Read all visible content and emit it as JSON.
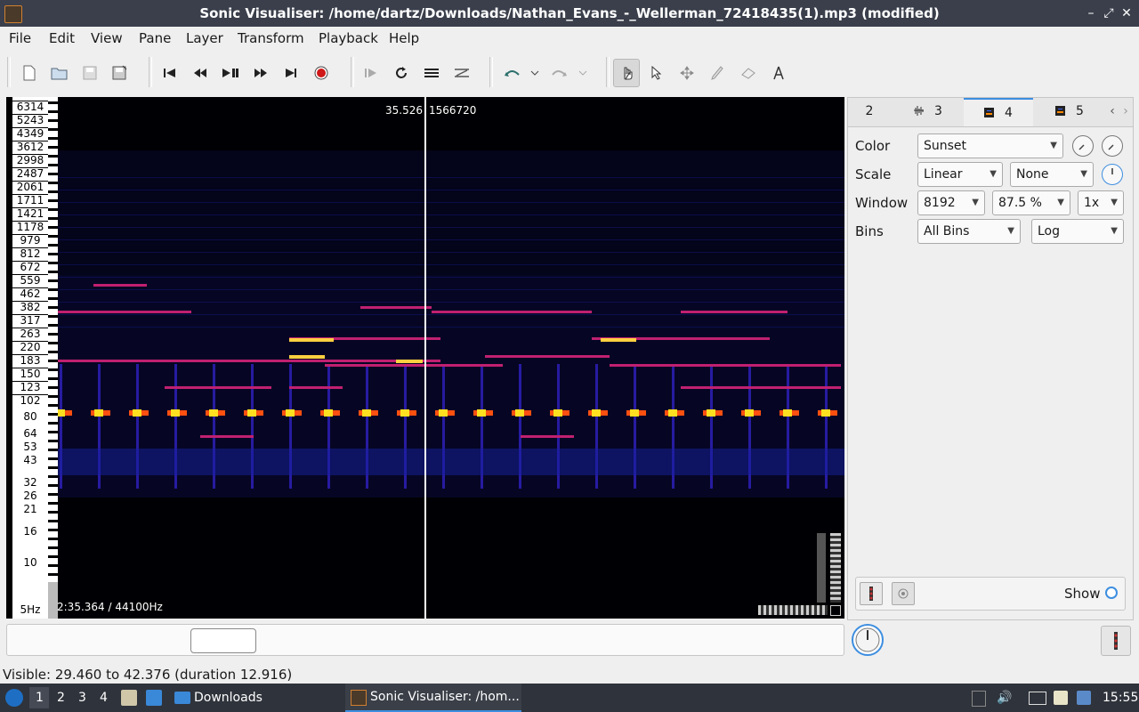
{
  "window": {
    "title": "Sonic Visualiser: /home/dartz/Downloads/Nathan_Evans_-_Wellerman_72418435(1).mp3 (modified)",
    "controls": {
      "minimize": "–",
      "maximize": "⤢",
      "close": "✕"
    }
  },
  "menu": [
    "File",
    "Edit",
    "View",
    "Pane",
    "Layer",
    "Transform",
    "Playback",
    "Help"
  ],
  "toolbar": {
    "icons": [
      "new-document-icon",
      "open-folder-icon",
      "save-icon",
      "save-session-icon",
      "rewind-start-icon",
      "rewind-icon",
      "play-pause-icon",
      "fast-forward-icon",
      "fast-forward-end-icon",
      "record-icon",
      "play-selection-icon",
      "loop-icon",
      "solo-icon",
      "playback-speedup-icon",
      "undo-icon",
      "undo-menu-icon",
      "redo-icon",
      "redo-menu-icon",
      "navigate-tool-icon",
      "select-tool-icon",
      "move-tool-icon",
      "draw-tool-icon",
      "erase-tool-icon",
      "measure-tool-icon"
    ]
  },
  "pane": {
    "scale_labels": [
      "6314",
      "5243",
      "4349",
      "3612",
      "2998",
      "2487",
      "2061",
      "1711",
      "1421",
      "1178",
      "979",
      "812",
      "672",
      "559",
      "462",
      "382",
      "317",
      "263",
      "220",
      "183",
      "150",
      "123",
      "102",
      "80",
      "64",
      "53",
      "43",
      "32",
      "26",
      "21",
      "16",
      "10",
      "5Hz"
    ],
    "cursor_time": "35.526",
    "cursor_frame": "1566720",
    "duration_rate": "2:35.364 / 44100Hz"
  },
  "layer_panel": {
    "tabs": [
      {
        "label": "2",
        "icon": ""
      },
      {
        "label": "3",
        "icon": "waveform-icon"
      },
      {
        "label": "4",
        "icon": "spectrogram-icon"
      },
      {
        "label": "5",
        "icon": "spectrogram-icon"
      }
    ],
    "active_tab": "4",
    "color_label": "Color",
    "color_value": "Sunset",
    "scale_label": "Scale",
    "scale_value": "Linear",
    "normalization_value": "None",
    "window_label": "Window",
    "window_size": "8192",
    "window_overlap": "87.5 %",
    "oversampling": "1x",
    "bins_label": "Bins",
    "bins_value": "All Bins",
    "bins_scale": "Log",
    "show_label": "Show"
  },
  "status": {
    "visible_range": "Visible: 29.460 to 42.376 (duration 12.916)"
  },
  "taskbar": {
    "workspaces": [
      "1",
      "2",
      "3",
      "4"
    ],
    "folder_label": "Downloads",
    "window_label": "Sonic Visualiser: /hom...",
    "clock": "15:55"
  },
  "colors": {
    "accent": "#3d8ee0",
    "spectrogram_bg": "#000000",
    "taskbar": "#2f333b"
  }
}
